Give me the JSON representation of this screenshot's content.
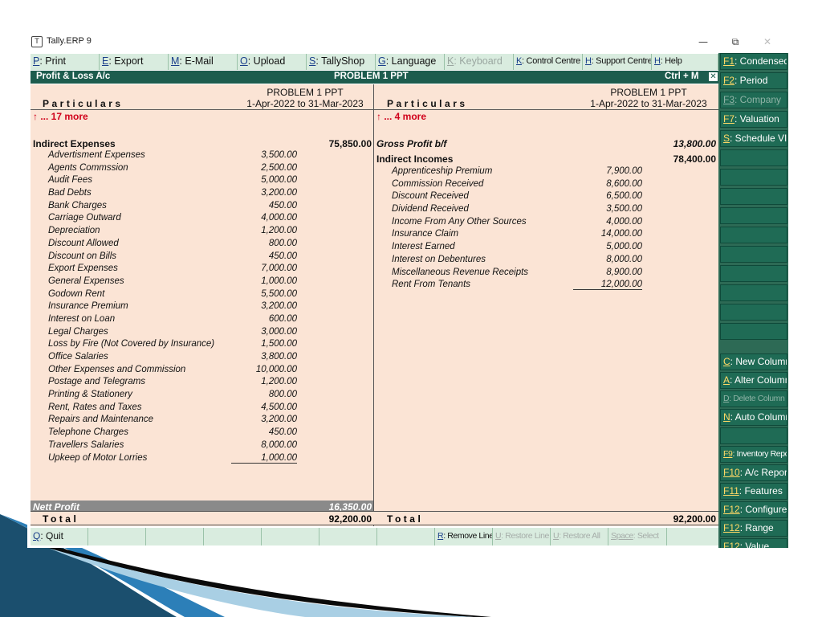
{
  "window": {
    "title": "Tally.ERP 9",
    "minimize_glyph": "—",
    "restore_glyph": "⧉",
    "close_glyph": "✕"
  },
  "top_menu": [
    {
      "key": "P",
      "rest": ": Print",
      "enabled": true
    },
    {
      "key": "E",
      "rest": ": Export",
      "enabled": true
    },
    {
      "key": "M",
      "rest": ": E-Mail",
      "enabled": true
    },
    {
      "key": "O",
      "rest": ": Upload",
      "enabled": true
    },
    {
      "key": "S",
      "rest": ": TallyShop",
      "enabled": true
    },
    {
      "key": "G",
      "rest": ": Language",
      "enabled": true
    },
    {
      "key": "K",
      "rest": ": Keyboard",
      "enabled": false
    },
    {
      "key": "K",
      "rest": ": Control Centre",
      "enabled": true
    },
    {
      "key": "H",
      "rest": ": Support Centre",
      "enabled": true
    },
    {
      "key": "H",
      "rest": ": Help",
      "enabled": true
    }
  ],
  "report": {
    "title": "Profit & Loss A/c",
    "company_header": "PROBLEM 1 PPT",
    "shortcut": "Ctrl + M",
    "close_glyph": "✕",
    "particulars_label": "Particulars",
    "period": "1-Apr-2022 to 31-Mar-2023",
    "left": {
      "more": "↑ ... 17 more",
      "group_name": "Indirect Expenses",
      "group_total": "75,850.00",
      "items": [
        {
          "name": "Advertisment Expenses",
          "amount": "3,500.00"
        },
        {
          "name": "Agents Commssion",
          "amount": "2,500.00"
        },
        {
          "name": "Audit Fees",
          "amount": "5,000.00"
        },
        {
          "name": "Bad Debts",
          "amount": "3,200.00"
        },
        {
          "name": "Bank Charges",
          "amount": "450.00"
        },
        {
          "name": "Carriage Outward",
          "amount": "4,000.00"
        },
        {
          "name": "Depreciation",
          "amount": "1,200.00"
        },
        {
          "name": "Discount Allowed",
          "amount": "800.00"
        },
        {
          "name": "Discount on Bills",
          "amount": "450.00"
        },
        {
          "name": "Export Expenses",
          "amount": "7,000.00"
        },
        {
          "name": "General Expenses",
          "amount": "1,000.00"
        },
        {
          "name": "Godown Rent",
          "amount": "5,500.00"
        },
        {
          "name": "Insurance Premium",
          "amount": "3,200.00"
        },
        {
          "name": "Interest on Loan",
          "amount": "600.00"
        },
        {
          "name": "Legal Charges",
          "amount": "3,000.00"
        },
        {
          "name": "Loss by Fire (Not Covered by Insurance)",
          "amount": "1,500.00"
        },
        {
          "name": "Office Salaries",
          "amount": "3,800.00"
        },
        {
          "name": "Other Expenses and Commission",
          "amount": "10,000.00"
        },
        {
          "name": "Postage and Telegrams",
          "amount": "1,200.00"
        },
        {
          "name": "Printing & Stationery",
          "amount": "800.00"
        },
        {
          "name": "Rent, Rates and Taxes",
          "amount": "4,500.00"
        },
        {
          "name": "Repairs and Maintenance",
          "amount": "3,200.00"
        },
        {
          "name": "Telephone Charges",
          "amount": "450.00"
        },
        {
          "name": "Travellers Salaries",
          "amount": "8,000.00"
        },
        {
          "name": "Upkeep of Motor Lorries",
          "amount": "1,000.00"
        }
      ],
      "nett_profit_label": "Nett Profit",
      "nett_profit_amount": "16,350.00",
      "total_label": "Total",
      "total_amount": "92,200.00"
    },
    "right": {
      "more": "↑ ... 4 more",
      "gross_profit_label": "Gross Profit b/f",
      "gross_profit_amount": "13,800.00",
      "group_name": "Indirect Incomes",
      "group_total": "78,400.00",
      "items": [
        {
          "name": "Apprenticeship Premium",
          "amount": "7,900.00"
        },
        {
          "name": "Commission Received",
          "amount": "8,600.00"
        },
        {
          "name": "Discount Received",
          "amount": "6,500.00"
        },
        {
          "name": "Dividend Received",
          "amount": "3,500.00"
        },
        {
          "name": "Income From Any Other Sources",
          "amount": "4,000.00"
        },
        {
          "name": "Insurance Claim",
          "amount": "14,000.00"
        },
        {
          "name": "Interest Earned",
          "amount": "5,000.00"
        },
        {
          "name": "Interest on Debentures",
          "amount": "8,000.00"
        },
        {
          "name": "Miscellaneous Revenue Receipts",
          "amount": "8,900.00"
        },
        {
          "name": "Rent From Tenants",
          "amount": "12,000.00"
        }
      ],
      "total_label": "Total",
      "total_amount": "92,200.00"
    }
  },
  "bottom_bar": {
    "quit": {
      "key": "Q",
      "rest": ": Quit"
    },
    "remove_line": {
      "key": "R",
      "rest": ": Remove Line"
    },
    "restore_line": {
      "key": "U",
      "rest": ": Restore Line"
    },
    "restore_all": {
      "key": "U",
      "rest": ": Restore All"
    },
    "space_select": {
      "key": "Space",
      "rest": ": Select"
    }
  },
  "right_panel": [
    {
      "key": "F1",
      "rest": ": Condensed",
      "enabled": true
    },
    {
      "key": "F2",
      "rest": ": Period",
      "enabled": true
    },
    {
      "key": "F3",
      "rest": ": Company",
      "enabled": false
    },
    {
      "key": "F7",
      "rest": ": Valuation",
      "enabled": true
    },
    {
      "key": "S",
      "rest": ": Schedule VI",
      "enabled": true
    },
    {
      "key": "C",
      "rest": ": New Column",
      "enabled": true
    },
    {
      "key": "A",
      "rest": ": Alter Column",
      "enabled": true
    },
    {
      "key": "D",
      "rest": ": Delete Column",
      "enabled": false
    },
    {
      "key": "N",
      "rest": ": Auto Column",
      "enabled": true
    },
    {
      "key": "F9",
      "rest": ": Inventory Reports",
      "enabled": true
    },
    {
      "key": "F10",
      "rest": ": A/c Reports",
      "enabled": true
    },
    {
      "key": "F11",
      "rest": ": Features",
      "enabled": true
    },
    {
      "key": "F12",
      "rest": ": Configure",
      "enabled": true
    },
    {
      "key": "F12",
      "rest": ": Range",
      "enabled": true
    },
    {
      "key": "F12",
      "rest": ": Value",
      "enabled": true
    }
  ],
  "colors": {
    "report_bg": "#fbe4d5",
    "header_bar": "#1d5c4e",
    "menu_bg": "#d9ecdf",
    "panel_bg": "#2d6a55",
    "accent_red": "#d0001b"
  }
}
